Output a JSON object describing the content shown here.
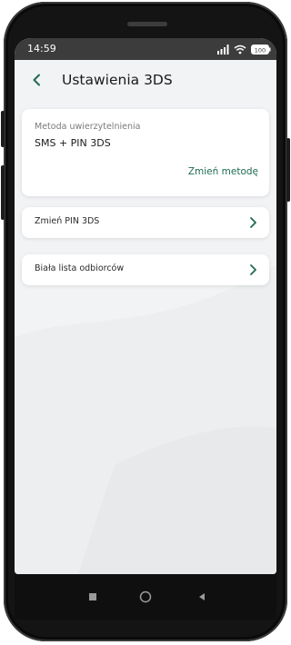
{
  "status_bar": {
    "time": "14:59",
    "icons": [
      "signal-icon",
      "wifi-icon",
      "battery-icon"
    ],
    "battery_label": "100"
  },
  "header": {
    "back_icon": "chevron-left-icon",
    "title": "Ustawienia 3DS"
  },
  "auth_method": {
    "label": "Metoda uwierzytelnienia",
    "value": "SMS + PIN 3DS",
    "change_link": "Zmień metodę"
  },
  "menu_items": [
    {
      "label": "Zmień PIN 3DS",
      "icon": "chevron-right-icon"
    },
    {
      "label": "Biała lista odbiorców",
      "icon": "chevron-right-icon"
    }
  ],
  "nav_bar": {
    "icons": [
      "recent-apps-icon",
      "home-icon",
      "back-icon"
    ]
  },
  "colors": {
    "accent": "#1e6b4e",
    "status_bar": "#3c3c3c",
    "background": "#f2f3f4",
    "frame": "#141414"
  }
}
